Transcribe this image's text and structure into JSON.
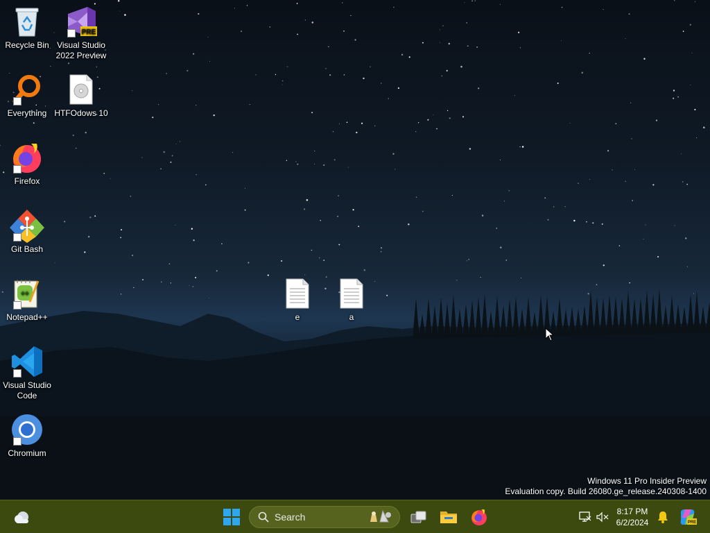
{
  "desktop_icons": [
    {
      "label": "Recycle Bin",
      "icon": "recycle-bin-icon"
    },
    {
      "label": "Visual Studio 2022 Preview",
      "icon": "visual-studio-preview-icon",
      "badge": "PRE"
    },
    {
      "label": "Everything",
      "icon": "everything-search-icon"
    },
    {
      "label": "HTFOdows 10",
      "icon": "disc-image-file-icon"
    },
    {
      "label": "Firefox",
      "icon": "firefox-icon"
    },
    {
      "label": "Git Bash",
      "icon": "git-bash-icon"
    },
    {
      "label": "Notepad++",
      "icon": "notepad-plus-plus-icon"
    },
    {
      "label": "Visual Studio Code",
      "icon": "vscode-icon"
    },
    {
      "label": "Chromium",
      "icon": "chromium-icon"
    },
    {
      "label": "e",
      "icon": "text-file-icon"
    },
    {
      "label": "a",
      "icon": "text-file-icon"
    }
  ],
  "watermark": {
    "line1": "Windows 11 Pro Insider Preview",
    "line2": "Evaluation copy. Build 26080.ge_release.240308-1400"
  },
  "taskbar": {
    "search_placeholder": "Search",
    "clock_time": "8:17 PM",
    "clock_date": "6/2/2024",
    "copilot_badge": "PRE",
    "accent": "#3c4a10"
  }
}
